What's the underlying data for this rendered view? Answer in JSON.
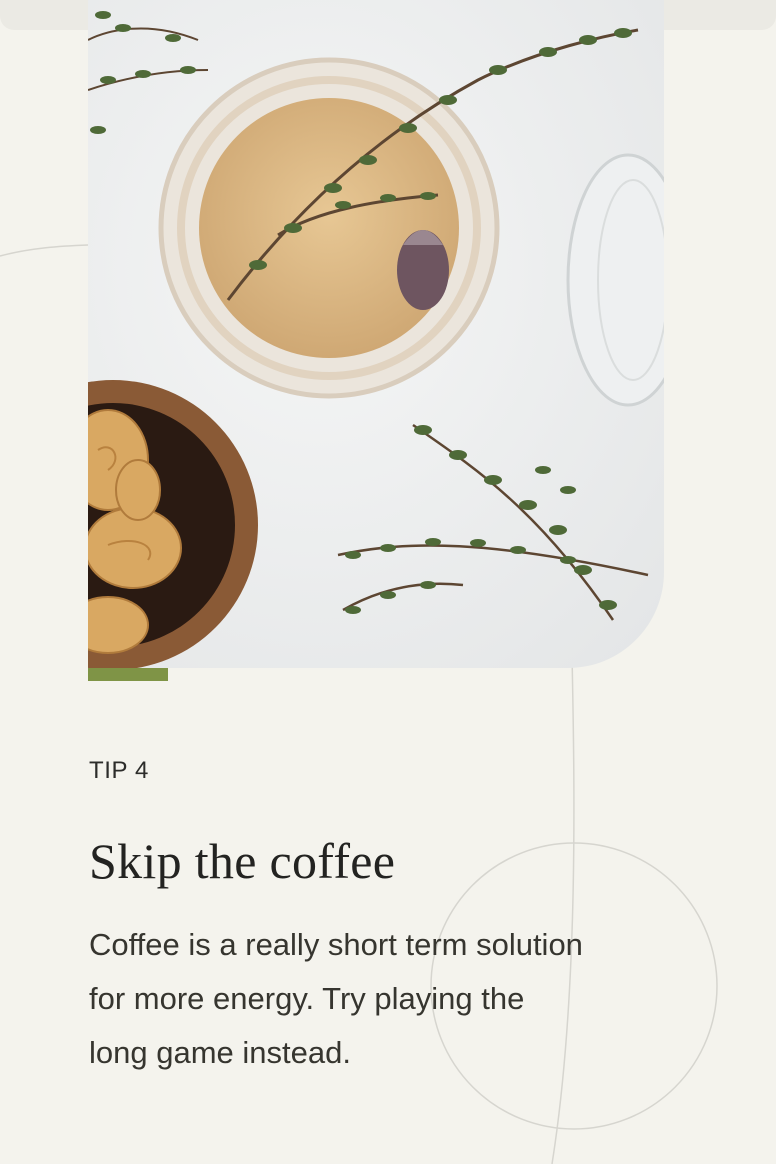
{
  "colors": {
    "page_background": "#f4f3ed",
    "accent": "#7f9446",
    "text": "#2c2c2a"
  },
  "hero": {
    "image": "overhead photo of a glass of herbal tea with thyme sprigs, a wooden bowl of palmier cookies and a tipped-over glass"
  },
  "tip": {
    "label": "TIP 4",
    "title": "Skip the coffee",
    "body": "Coffee is a really short term solution for more energy. Try playing the long game instead."
  },
  "icons": {
    "top_right": "menu-icon"
  }
}
